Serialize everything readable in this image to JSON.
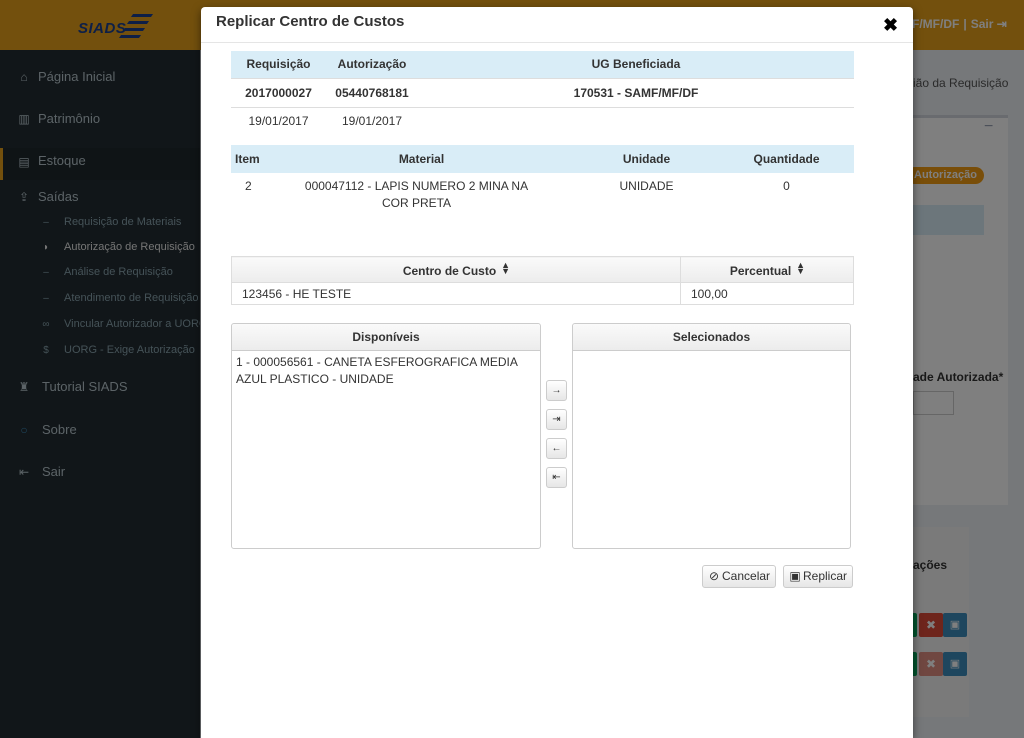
{
  "app": {
    "logo_text": "SIADS",
    "user_org": "F/MF/DF",
    "logout_label": "Sair"
  },
  "sidebar": {
    "items": [
      {
        "label": "Página Inicial",
        "icon": "home-icon"
      },
      {
        "label": "Patrimônio",
        "icon": "barcode-icon"
      },
      {
        "label": "Estoque",
        "icon": "box-icon"
      },
      {
        "label": "Saídas",
        "icon": "upload-icon"
      },
      {
        "label": "Tutorial SIADS",
        "icon": "graduation-cap-icon"
      },
      {
        "label": "Sobre",
        "icon": "circle-icon"
      },
      {
        "label": "Sair",
        "icon": "sign-out-icon"
      }
    ],
    "subitems": [
      {
        "label": "Requisição de Materiais",
        "icon": "dash-icon"
      },
      {
        "label": "Autorização de Requisição",
        "icon": "shield-icon"
      },
      {
        "label": "Análise de Requisição",
        "icon": "dash-icon"
      },
      {
        "label": "Atendimento de Requisição",
        "icon": "dash-icon"
      },
      {
        "label": "Vincular Autorizador a UORG",
        "icon": "link-icon"
      },
      {
        "label": "UORG - Exige Autorização",
        "icon": "dollar-icon"
      }
    ]
  },
  "background": {
    "breadcrumb": "ião da Requisição",
    "badge": "Autorização",
    "qty_label": "ade Autorizada*",
    "actions_label": "ações",
    "colors": {
      "green": "#00a65a",
      "red": "#dd4b39",
      "blue": "#3c8dbc"
    }
  },
  "modal": {
    "title": "Replicar Centro de Custos",
    "close_icon": "close-icon",
    "requisicao": {
      "headers": {
        "requisicao": "Requisição",
        "autorizacao": "Autorização",
        "ug": "UG Beneficiada"
      },
      "row1": {
        "requisicao": "2017000027",
        "autorizacao": "05440768181",
        "ug": "170531 - SAMF/MF/DF"
      },
      "row2": {
        "requisicao": "19/01/2017",
        "autorizacao": "19/01/2017"
      }
    },
    "item_table": {
      "headers": {
        "item": "Item",
        "material": "Material",
        "unidade": "Unidade",
        "quantidade": "Quantidade"
      },
      "row": {
        "item": "2",
        "material": "000047112 - LAPIS NUMERO 2 MINA NA COR PRETA",
        "unidade": "UNIDADE",
        "quantidade": "0"
      }
    },
    "centro_custo": {
      "headers": {
        "centro": "Centro de Custo",
        "percentual": "Percentual"
      },
      "row": {
        "centro": "123456 - HE TESTE",
        "percentual": "100,00"
      }
    },
    "disponiveis": {
      "header": "Disponíveis",
      "items": [
        "1 - 000056561 - CANETA ESFEROGRAFICA MEDIA AZUL PLASTICO - UNIDADE"
      ]
    },
    "selecionados": {
      "header": "Selecionados",
      "items": []
    },
    "move_buttons": {
      "move_right": "→",
      "move_all_right": "⇥",
      "move_left": "←",
      "move_all_left": "⇤"
    },
    "buttons": {
      "cancel": "Cancelar",
      "replicate": "Replicar"
    }
  }
}
